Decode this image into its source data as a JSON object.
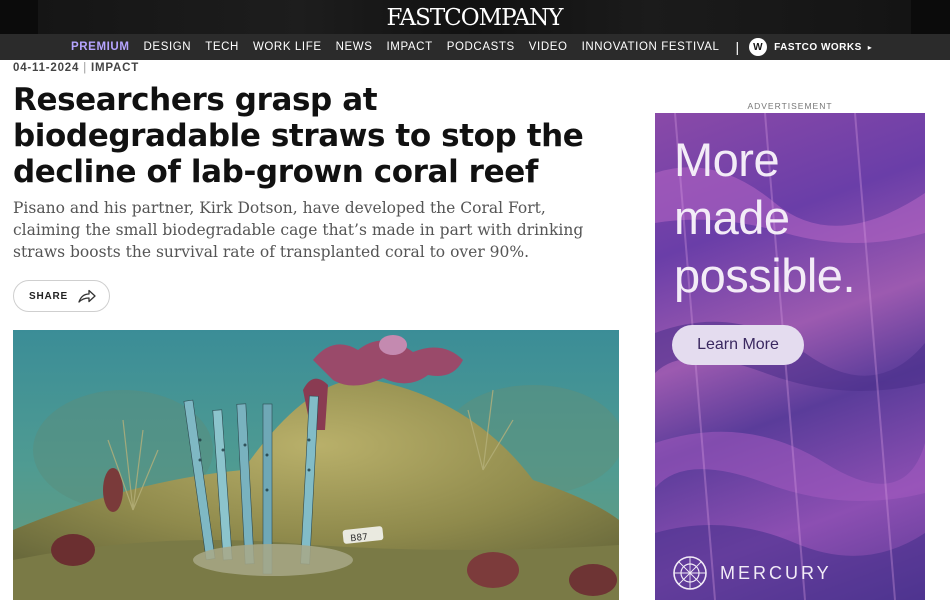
{
  "header": {
    "logo": "FASTCOMPANY"
  },
  "nav": {
    "items": [
      "PREMIUM",
      "DESIGN",
      "TECH",
      "WORK LIFE",
      "NEWS",
      "IMPACT",
      "PODCASTS",
      "VIDEO",
      "INNOVATION FESTIVAL"
    ],
    "separator": "|",
    "works_badge": "W",
    "works_label": "FASTCO WORKS",
    "works_arrow": "▸"
  },
  "article": {
    "date": "04-11-2024",
    "meta_separator": "|",
    "section": "IMPACT",
    "headline": "Researchers grasp at biodegradable straws to stop the decline of lab-grown coral reef",
    "dek": "Pisano and his partner, Kirk Dotson, have developed the Coral Fort, claiming the small biodegradable cage that’s made in part with drinking straws boosts the survival rate of transplanted coral to over 90%.",
    "share_label": "SHARE",
    "hero_tag": "B87"
  },
  "ad": {
    "label": "ADVERTISEMENT",
    "headline_lines": [
      "More",
      "made",
      "possible."
    ],
    "button": "Learn More",
    "brand": "MERCURY"
  },
  "icons": {
    "share": "share-arrow-icon",
    "brand": "mercury-logo-icon"
  },
  "colors": {
    "premium": "#b6a4ff",
    "nav_bg": "#2b2b2b",
    "ad_button": "#e4dcef"
  }
}
